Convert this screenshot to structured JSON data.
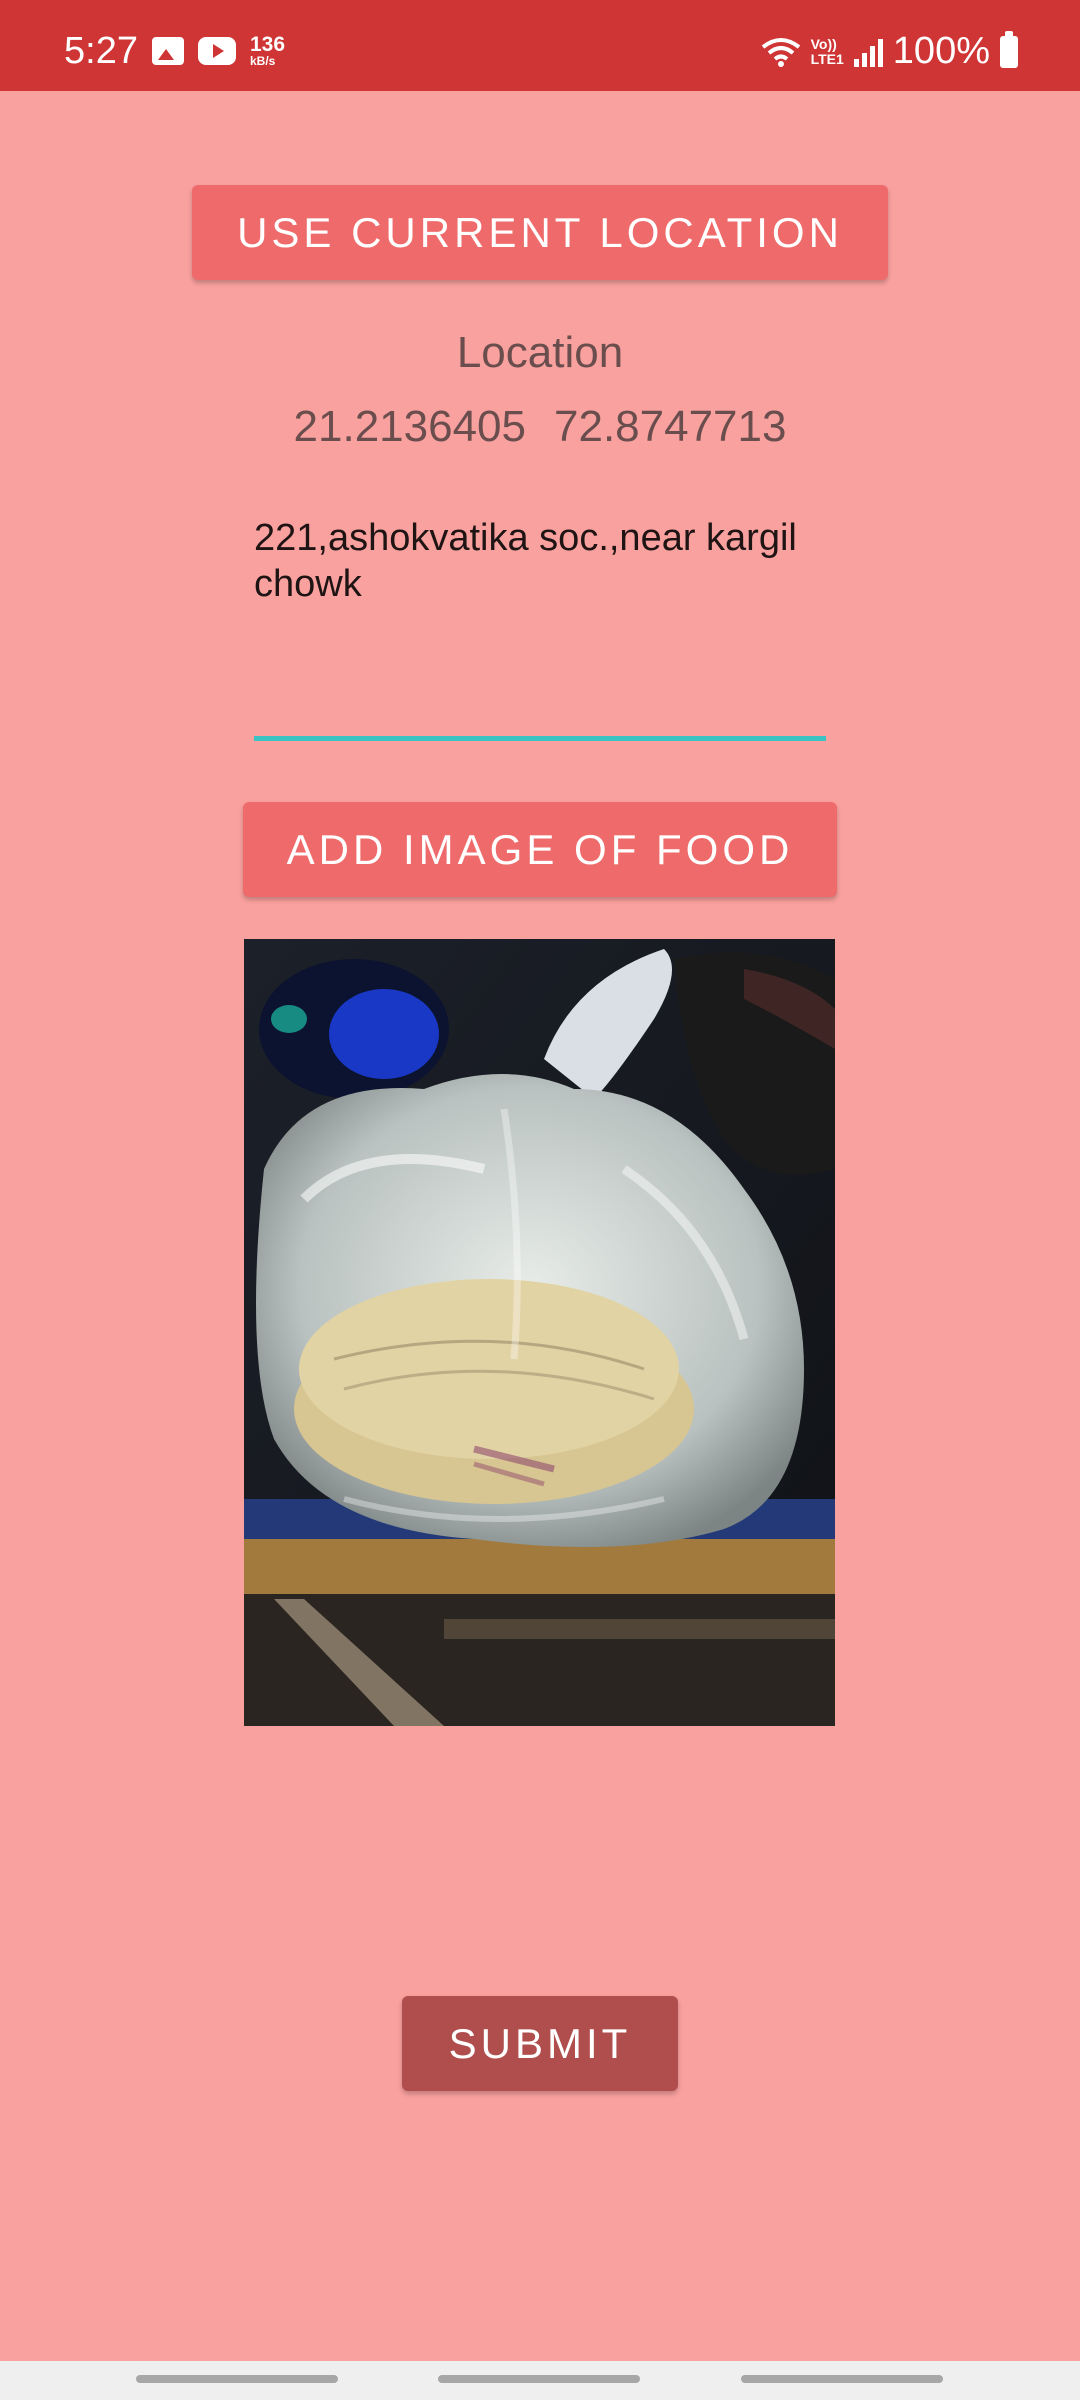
{
  "status_bar": {
    "time": "5:27",
    "net_speed_value": "136",
    "net_speed_unit": "kB/s",
    "volte_line1": "Vo))",
    "volte_line2": "LTE1",
    "battery": "100%",
    "icons": [
      "gallery-icon",
      "youtube-icon",
      "wifi-icon",
      "signal-icon",
      "battery-icon"
    ]
  },
  "main": {
    "use_location_label": "USE CURRENT LOCATION",
    "location_title": "Location",
    "latitude": "21.2136405",
    "longitude": "72.8747713",
    "address_value": "221,ashokvatika soc.,near kargil chowk",
    "add_image_label": "ADD IMAGE OF FOOD",
    "submit_label": "SUBMIT"
  },
  "colors": {
    "background": "#f9a19f",
    "status_bar": "#cf3535",
    "button": "#ef6a6a",
    "submit_button": "#b04e4e",
    "field_underline": "#3bc2c3"
  }
}
